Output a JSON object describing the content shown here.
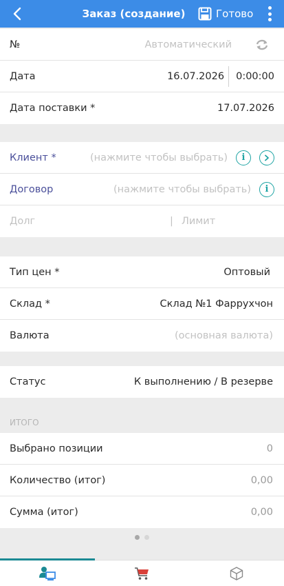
{
  "header": {
    "back_icon": "chevron-left-icon",
    "title": "Заказ (создание)",
    "save_icon": "floppy-disk-icon",
    "save_label": "Готово",
    "menu_icon": "more-vertical-icon",
    "color": "#3c8ce7"
  },
  "doc": {
    "number_label": "№",
    "number_value": "Автоматический",
    "refresh_icon": "refresh-icon",
    "date_label": "Дата",
    "date_value": "16.07.2026",
    "time_value": "0:00:00",
    "delivery_label": "Дата поставки *",
    "delivery_value": "17.07.2026"
  },
  "client": {
    "client_label": "Клиент *",
    "client_placeholder": "(нажмите чтобы выбрать)",
    "contract_label": "Договор",
    "contract_placeholder": "(нажмите чтобы выбрать)",
    "debt_label": "Долг",
    "separator": "|",
    "limit_label": "Лимит",
    "accent_color": "#1ca3a3"
  },
  "params": {
    "price_type_label": "Тип цен *",
    "price_type_value": "Оптовый",
    "warehouse_label": "Склад *",
    "warehouse_value": "Склад №1 Фаррухчон",
    "currency_label": "Валюта",
    "currency_placeholder": "(основная валюта)"
  },
  "status": {
    "label": "Статус",
    "value": "К выполнению / В резерве"
  },
  "totals": {
    "section_title": "ИТОГО",
    "positions_label": "Выбрано позиции",
    "positions_value": "0",
    "quantity_label": "Количество (итог)",
    "quantity_value": "0,00",
    "sum_label": "Сумма (итог)",
    "sum_value": "0,00"
  },
  "pager": {
    "pages": 2,
    "current": 1
  },
  "tabs": [
    {
      "icon": "client-computer-icon",
      "active": true
    },
    {
      "icon": "shopping-cart-icon",
      "active": false
    },
    {
      "icon": "package-box-icon",
      "active": false
    }
  ]
}
